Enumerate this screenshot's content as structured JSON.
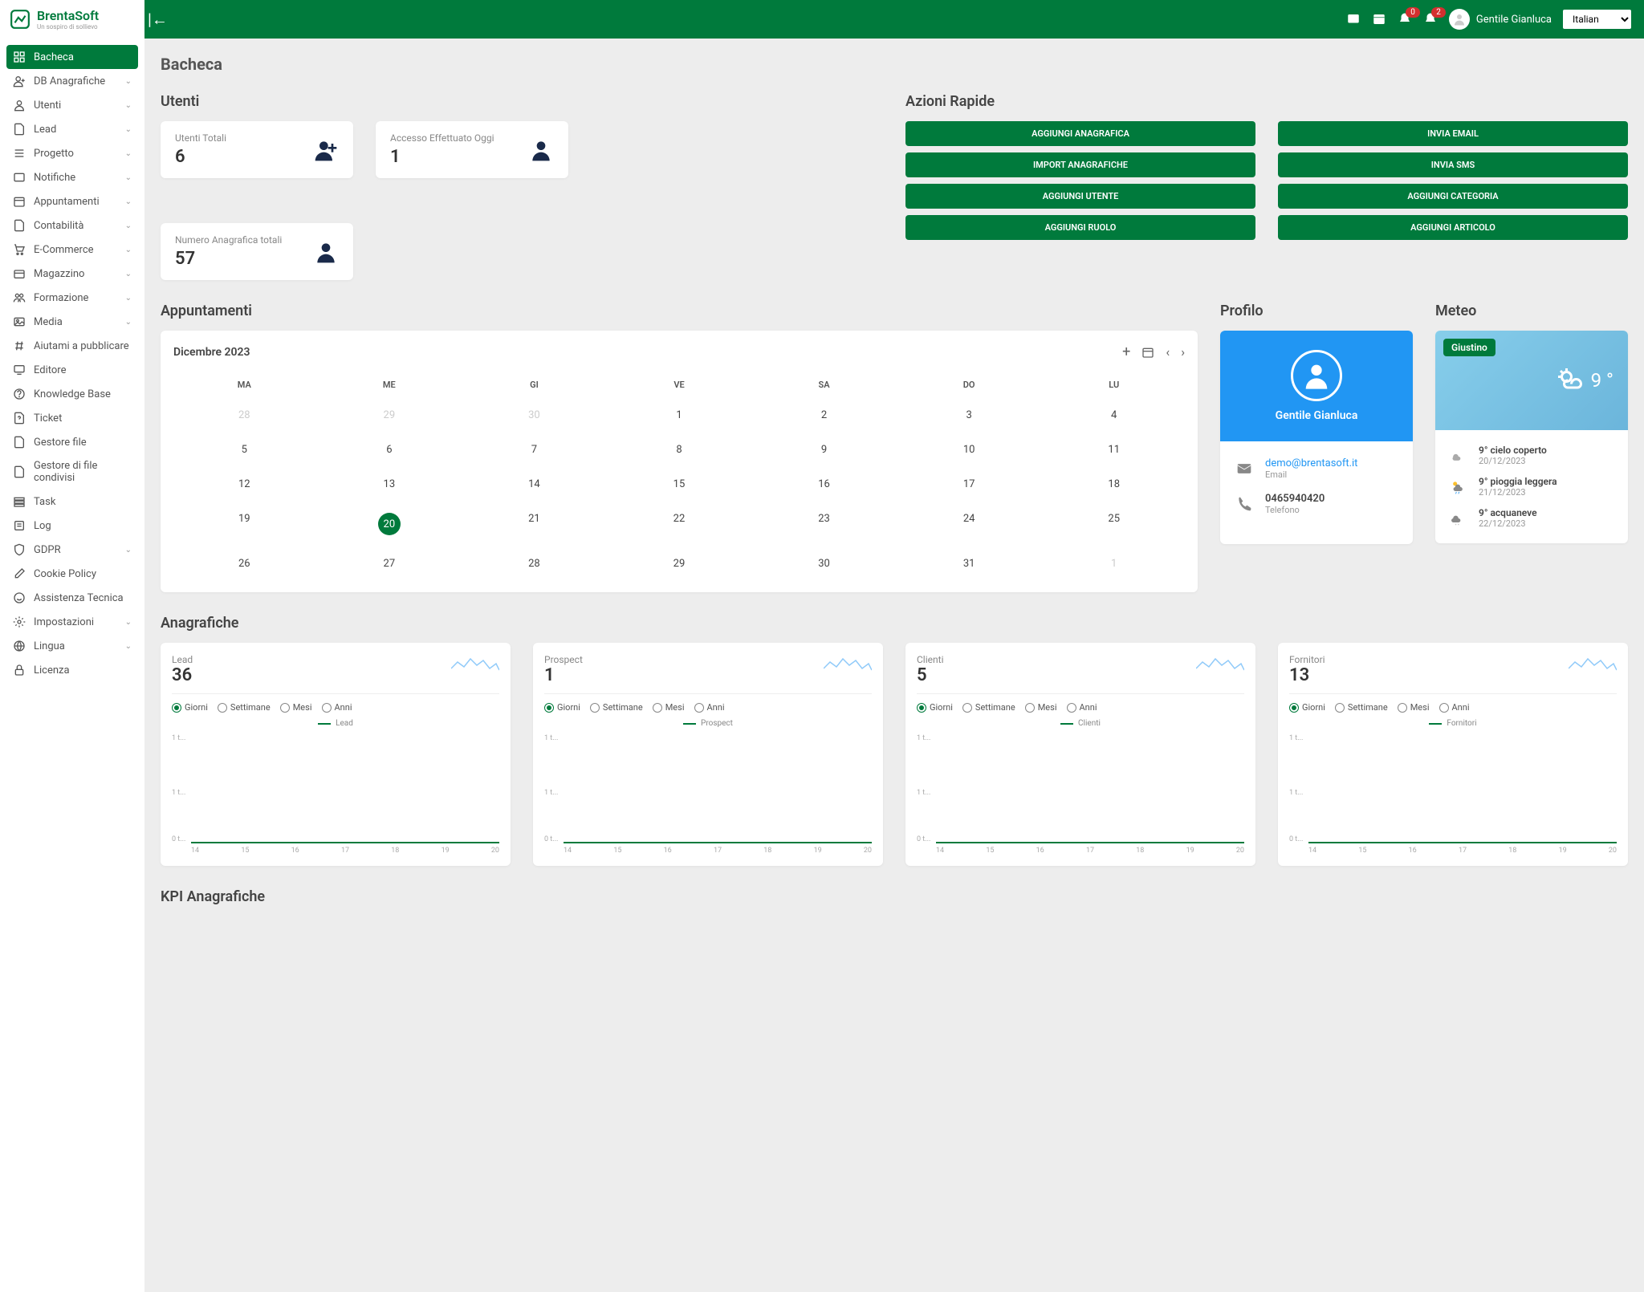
{
  "brand": {
    "name": "BrentaSoft",
    "tagline": "Un sospiro di sollievo"
  },
  "header": {
    "user": "Gentile Gianluca",
    "language": "Italian",
    "notif1_count": "0",
    "notif2_count": "2"
  },
  "sidebar": {
    "items": [
      {
        "label": "Bacheca",
        "icon": "dashboard",
        "active": true,
        "expandable": false
      },
      {
        "label": "DB Anagrafiche",
        "icon": "person-add",
        "expandable": true
      },
      {
        "label": "Utenti",
        "icon": "person",
        "expandable": true
      },
      {
        "label": "Lead",
        "icon": "file",
        "expandable": true
      },
      {
        "label": "Progetto",
        "icon": "list",
        "expandable": true
      },
      {
        "label": "Notifiche",
        "icon": "alert",
        "expandable": true
      },
      {
        "label": "Appuntamenti",
        "icon": "calendar",
        "expandable": true
      },
      {
        "label": "Contabilità",
        "icon": "file",
        "expandable": true
      },
      {
        "label": "E-Commerce",
        "icon": "cart",
        "expandable": true
      },
      {
        "label": "Magazzino",
        "icon": "box",
        "expandable": true
      },
      {
        "label": "Formazione",
        "icon": "group",
        "expandable": true
      },
      {
        "label": "Media",
        "icon": "image",
        "expandable": true
      },
      {
        "label": "Aiutami a pubblicare",
        "icon": "hash",
        "expandable": false
      },
      {
        "label": "Editore",
        "icon": "monitor",
        "expandable": false
      },
      {
        "label": "Knowledge Base",
        "icon": "help",
        "expandable": false
      },
      {
        "label": "Ticket",
        "icon": "file-q",
        "expandable": false
      },
      {
        "label": "Gestore file",
        "icon": "file",
        "expandable": false
      },
      {
        "label": "Gestore di file condivisi",
        "icon": "file",
        "expandable": false
      },
      {
        "label": "Task",
        "icon": "tasks",
        "expandable": false
      },
      {
        "label": "Log",
        "icon": "log",
        "expandable": false
      },
      {
        "label": "GDPR",
        "icon": "shield",
        "expandable": true
      },
      {
        "label": "Cookie Policy",
        "icon": "pencil",
        "expandable": false
      },
      {
        "label": "Assistenza Tecnica",
        "icon": "support",
        "expandable": false
      },
      {
        "label": "Impostazioni",
        "icon": "gear",
        "expandable": true
      },
      {
        "label": "Lingua",
        "icon": "lang",
        "expandable": true
      },
      {
        "label": "Licenza",
        "icon": "lock",
        "expandable": false
      }
    ]
  },
  "page": {
    "title": "Bacheca"
  },
  "sections": {
    "users_title": "Utenti",
    "actions_title": "Azioni Rapide",
    "appointments_title": "Appuntamenti",
    "profile_title": "Profilo",
    "weather_title": "Meteo",
    "anagrafiche_title": "Anagrafiche",
    "kpi_title": "KPI Anagrafiche"
  },
  "stats": [
    {
      "label": "Utenti Totali",
      "value": "6",
      "icon": "person-add"
    },
    {
      "label": "Accesso Effettuato Oggi",
      "value": "1",
      "icon": "person"
    },
    {
      "label": "Numero Anagrafica totali",
      "value": "57",
      "icon": "person"
    }
  ],
  "actions": {
    "left": [
      "AGGIUNGI ANAGRAFICA",
      "IMPORT ANAGRAFICHE",
      "AGGIUNGI UTENTE",
      "AGGIUNGI RUOLO"
    ],
    "right": [
      "INVIA EMAIL",
      "INVIA SMS",
      "AGGIUNGI CATEGORIA",
      "AGGIUNGI ARTICOLO"
    ]
  },
  "calendar": {
    "month": "Dicembre 2023",
    "dow": [
      "MA",
      "ME",
      "GI",
      "VE",
      "SA",
      "DO",
      "LU"
    ],
    "weeks": [
      [
        {
          "d": "28",
          "m": true
        },
        {
          "d": "29",
          "m": true
        },
        {
          "d": "30",
          "m": true
        },
        {
          "d": "1"
        },
        {
          "d": "2"
        },
        {
          "d": "3"
        },
        {
          "d": "4"
        }
      ],
      [
        {
          "d": "5"
        },
        {
          "d": "6"
        },
        {
          "d": "7"
        },
        {
          "d": "8"
        },
        {
          "d": "9"
        },
        {
          "d": "10"
        },
        {
          "d": "11"
        }
      ],
      [
        {
          "d": "12"
        },
        {
          "d": "13"
        },
        {
          "d": "14"
        },
        {
          "d": "15"
        },
        {
          "d": "16"
        },
        {
          "d": "17"
        },
        {
          "d": "18"
        }
      ],
      [
        {
          "d": "19"
        },
        {
          "d": "20",
          "today": true
        },
        {
          "d": "21"
        },
        {
          "d": "22"
        },
        {
          "d": "23"
        },
        {
          "d": "24"
        },
        {
          "d": "25"
        }
      ],
      [
        {
          "d": "26"
        },
        {
          "d": "27"
        },
        {
          "d": "28"
        },
        {
          "d": "29"
        },
        {
          "d": "30"
        },
        {
          "d": "31"
        },
        {
          "d": "1",
          "m": true
        }
      ]
    ]
  },
  "profile": {
    "name": "Gentile Gianluca",
    "email": "demo@brentasoft.it",
    "email_label": "Email",
    "phone": "0465940420",
    "phone_label": "Telefono"
  },
  "weather": {
    "location": "Giustino",
    "temp": "9 °",
    "forecast": [
      {
        "desc": "9° cielo coperto",
        "date": "20/12/2023"
      },
      {
        "desc": "9° pioggia leggera",
        "date": "21/12/2023"
      },
      {
        "desc": "9° acquaneve",
        "date": "22/12/2023"
      }
    ]
  },
  "anagrafiche": [
    {
      "label": "Lead",
      "value": "36",
      "legend": "Lead"
    },
    {
      "label": "Prospect",
      "value": "1",
      "legend": "Prospect"
    },
    {
      "label": "Clienti",
      "value": "5",
      "legend": "Clienti"
    },
    {
      "label": "Fornitori",
      "value": "13",
      "legend": "Fornitori"
    }
  ],
  "radio_options": [
    "Giorni",
    "Settimane",
    "Mesi",
    "Anni"
  ],
  "chart_data": [
    {
      "type": "line",
      "title": "Lead",
      "x": [
        14,
        15,
        16,
        17,
        18,
        19,
        20
      ],
      "series": [
        {
          "name": "Lead",
          "values": [
            0,
            0,
            0,
            0,
            0,
            0,
            0
          ]
        }
      ],
      "xlabel": "",
      "ylabel": "",
      "ylim": [
        0,
        1
      ],
      "y_ticks": [
        "0 t...",
        "1 t...",
        "1 t..."
      ]
    },
    {
      "type": "line",
      "title": "Prospect",
      "x": [
        14,
        15,
        16,
        17,
        18,
        19,
        20
      ],
      "series": [
        {
          "name": "Prospect",
          "values": [
            0,
            0,
            0,
            0,
            0,
            0,
            0
          ]
        }
      ],
      "xlabel": "",
      "ylabel": "",
      "ylim": [
        0,
        1
      ],
      "y_ticks": [
        "0 t...",
        "1 t...",
        "1 t..."
      ]
    },
    {
      "type": "line",
      "title": "Clienti",
      "x": [
        14,
        15,
        16,
        17,
        18,
        19,
        20
      ],
      "series": [
        {
          "name": "Clienti",
          "values": [
            0,
            0,
            0,
            0,
            0,
            0,
            0
          ]
        }
      ],
      "xlabel": "",
      "ylabel": "",
      "ylim": [
        0,
        1
      ],
      "y_ticks": [
        "0 t...",
        "1 t...",
        "1 t..."
      ]
    },
    {
      "type": "line",
      "title": "Fornitori",
      "x": [
        14,
        15,
        16,
        17,
        18,
        19,
        20
      ],
      "series": [
        {
          "name": "Fornitori",
          "values": [
            0,
            0,
            0,
            0,
            0,
            0,
            0
          ]
        }
      ],
      "xlabel": "",
      "ylabel": "",
      "ylim": [
        0,
        1
      ],
      "y_ticks": [
        "0 t...",
        "1 t...",
        "1 t..."
      ]
    }
  ]
}
